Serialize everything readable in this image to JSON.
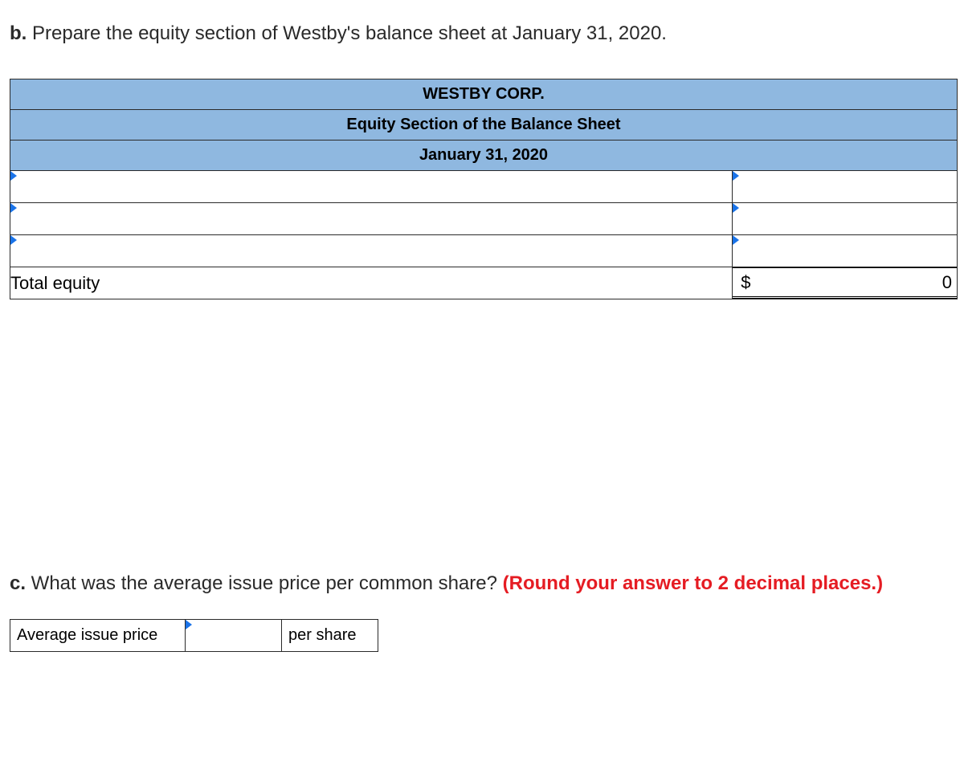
{
  "question_b": {
    "letter": "b.",
    "text": " Prepare the equity section of Westby's balance sheet at January 31, 2020."
  },
  "equity_table": {
    "header1": "WESTBY CORP.",
    "header2": "Equity Section of the Balance Sheet",
    "header3": "January 31, 2020",
    "total_label": "Total equity",
    "currency": "$",
    "total_value": "0"
  },
  "question_c": {
    "letter": "c.",
    "text": " What was the average issue price per common share? ",
    "red_text": "(Round your answer to 2 decimal places.)"
  },
  "avg_table": {
    "label": "Average issue price",
    "per_share": "per share"
  }
}
